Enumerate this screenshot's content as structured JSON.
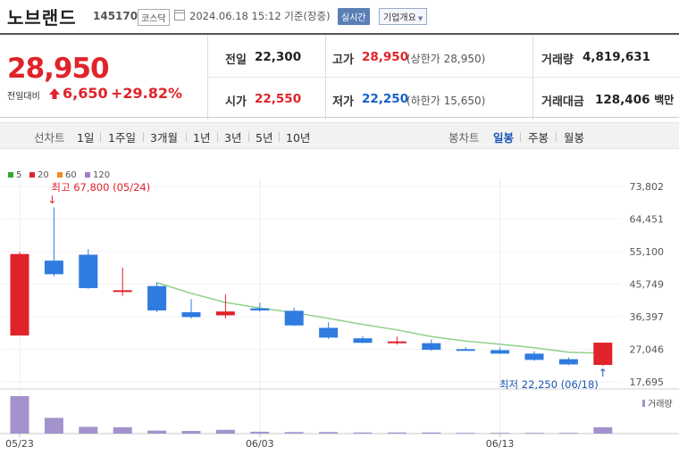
{
  "header": {
    "stock_name": "노브랜드",
    "stock_code": "145170",
    "market": "코스닥",
    "timestamp": "2024.06.18 15:12 기준(장중)",
    "realtime_badge": "실시간",
    "company_button": "기업개요"
  },
  "quote": {
    "price": "28,950",
    "change_label": "전일대비",
    "change_direction": "up",
    "change_value": "6,650",
    "change_pct": "+29.82%",
    "prev_close_label": "전일",
    "prev_close": "22,300",
    "high_label": "고가",
    "high": "28,950",
    "upper_limit": "(상한가 28,950)",
    "volume_label": "거래량",
    "volume": "4,819,631",
    "open_label": "시가",
    "open": "22,550",
    "low_label": "저가",
    "low": "22,250",
    "lower_limit": "(하한가 15,650)",
    "turnover_label": "거래대금",
    "turnover": "128,406",
    "turnover_unit": "백만"
  },
  "tabs": {
    "line_chart_label": "선차트",
    "line_periods": [
      "1일",
      "1주일",
      "3개월",
      "1년",
      "3년",
      "5년",
      "10년"
    ],
    "candle_chart_label": "봉차트",
    "candle_periods": [
      "일봉",
      "주봉",
      "월봉"
    ],
    "active_candle_period": "일봉"
  },
  "colors": {
    "up": "#e0232a",
    "down": "#2f7be0",
    "ma5": "#33a833",
    "ma20": "#e0232a",
    "ma60": "#f08a24",
    "ma120": "#9b7ec9",
    "ma_line": "#8ed08a",
    "volume": "#a392cc"
  },
  "chart_data": {
    "type": "candlestick",
    "legend": [
      {
        "label": "5",
        "color": "#33a833"
      },
      {
        "label": "20",
        "color": "#e0232a"
      },
      {
        "label": "60",
        "color": "#f08a24"
      },
      {
        "label": "120",
        "color": "#9b7ec9"
      }
    ],
    "y_ticks": [
      "73,802",
      "64,451",
      "55,100",
      "45,749",
      "36,397",
      "27,046",
      "17,695"
    ],
    "y_tick_values": [
      73802,
      64451,
      55100,
      45749,
      36397,
      27046,
      17695
    ],
    "x_ticks": [
      {
        "label": "05/23",
        "index": 0
      },
      {
        "label": "06/03",
        "index": 7
      },
      {
        "label": "06/13",
        "index": 14
      }
    ],
    "high_annotation": {
      "label": "최고 67,800 (05/24)",
      "index": 1,
      "value": 67800
    },
    "low_annotation": {
      "label": "최저 22,250 (06/18)",
      "index": 17,
      "value": 22250
    },
    "volume_label": "거래량",
    "candles": [
      {
        "o": 31000,
        "h": 55000,
        "l": 31000,
        "c": 54400,
        "v": 10.0
      },
      {
        "o": 52500,
        "h": 67800,
        "l": 48000,
        "c": 48600,
        "v": 4.2
      },
      {
        "o": 54200,
        "h": 55800,
        "l": 44400,
        "c": 44600,
        "v": 1.8
      },
      {
        "o": 43700,
        "h": 50500,
        "l": 42400,
        "c": 44000,
        "v": 1.7
      },
      {
        "o": 45200,
        "h": 46300,
        "l": 37700,
        "c": 38200,
        "v": 0.8
      },
      {
        "o": 37700,
        "h": 41500,
        "l": 35900,
        "c": 36300,
        "v": 0.7
      },
      {
        "o": 36800,
        "h": 42800,
        "l": 35900,
        "c": 37900,
        "v": 1.0
      },
      {
        "o": 38800,
        "h": 40400,
        "l": 37900,
        "c": 38200,
        "v": 0.5
      },
      {
        "o": 38100,
        "h": 39000,
        "l": 33700,
        "c": 33900,
        "v": 0.4
      },
      {
        "o": 33200,
        "h": 34800,
        "l": 30000,
        "c": 30400,
        "v": 0.4
      },
      {
        "o": 30200,
        "h": 30800,
        "l": 28800,
        "c": 28900,
        "v": 0.3
      },
      {
        "o": 29100,
        "h": 30700,
        "l": 28400,
        "c": 29300,
        "v": 0.3
      },
      {
        "o": 28800,
        "h": 29900,
        "l": 26600,
        "c": 26900,
        "v": 0.3
      },
      {
        "o": 27100,
        "h": 27600,
        "l": 26700,
        "c": 27000,
        "v": 0.2
      },
      {
        "o": 26800,
        "h": 27600,
        "l": 25700,
        "c": 25800,
        "v": 0.2
      },
      {
        "o": 25800,
        "h": 26500,
        "l": 23700,
        "c": 24000,
        "v": 0.2
      },
      {
        "o": 24200,
        "h": 24700,
        "l": 22500,
        "c": 22700,
        "v": 0.2
      },
      {
        "o": 22550,
        "h": 28950,
        "l": 22250,
        "c": 28950,
        "v": 1.7
      }
    ],
    "ma_line": [
      null,
      null,
      null,
      null,
      46200,
      43100,
      40500,
      38900,
      37600,
      35900,
      34200,
      32600,
      30700,
      29400,
      28500,
      27500,
      26200,
      25900
    ]
  }
}
